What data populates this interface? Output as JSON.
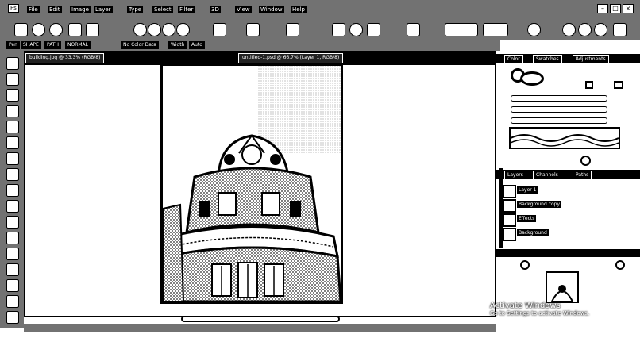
{
  "menubar": {
    "items": [
      "Ps",
      "File",
      "Edit",
      "Image",
      "Layer",
      "Type",
      "Select",
      "Filter",
      "3D",
      "View",
      "Window",
      "Help"
    ]
  },
  "window_controls": {
    "minimize": "–",
    "maximize": "□",
    "close": "×"
  },
  "options_bar": {
    "items": [
      "Pen",
      "SHAPE",
      "PATH",
      "NORMAL",
      "No Color Data",
      "Width",
      "Auto"
    ]
  },
  "document_tabs": [
    {
      "label": "building.jpg @ 33.3% (RGB/8)"
    },
    {
      "label": "untitled-1.psd @ 66.7% (Layer 1, RGB/8)"
    }
  ],
  "right_panel": {
    "top_tabs": [
      "Color",
      "Swatches",
      "Adjustments"
    ],
    "layers_header": [
      "Layers",
      "Channels",
      "Paths"
    ],
    "layers": [
      {
        "name": "Layer 1"
      },
      {
        "name": "Background copy"
      },
      {
        "name": "Effects"
      },
      {
        "name": "Background"
      }
    ]
  },
  "watermark": {
    "title": "Activate Windows",
    "subtitle": "Go to Settings to activate Windows."
  },
  "colors": {
    "ink": "#000000",
    "paper": "#ffffff",
    "mid": "#c8c8c8"
  }
}
